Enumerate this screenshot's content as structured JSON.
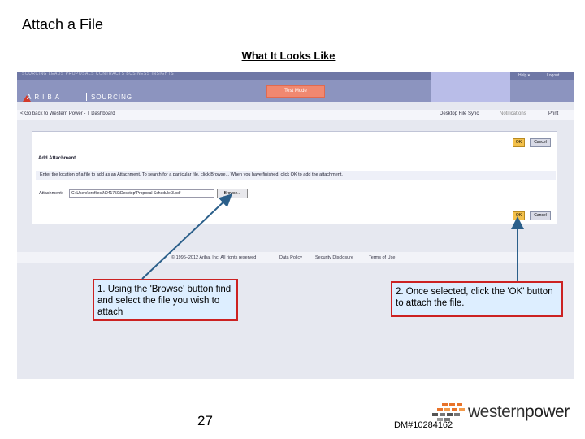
{
  "slide": {
    "title": "Attach a File",
    "subtitle": "What It Looks Like",
    "page_number": "27",
    "doc_number": "DM#10284162",
    "logo": {
      "western": "western",
      "power": "power"
    }
  },
  "app": {
    "top_tabs": "SOURCING   LEADS   PROPOSALS   CONTRACTS   BUSINESS INSIGHTS",
    "help": "Help ▾",
    "logout": "Logout",
    "test_mode": "Test Mode",
    "brand": "ARIBA",
    "module": "SOURCING",
    "back_link": "< Go back to Western Power - T Dashboard",
    "desktop_sync": "Desktop File Sync",
    "notifications": "Notifications",
    "print": "Print"
  },
  "dialog": {
    "title": "Add Attachment",
    "instructions": "Enter the location of a file to add as an Attachment. To search for a particular file, click Browse... When you have finished, click OK to add the attachment.",
    "attachment_label": "Attachment:",
    "attachment_value": "C:\\Users\\profiles\\N041750\\Desktop\\Proposal Schedule 3.pdf",
    "browse_label": "Browse...",
    "ok_label": "OK",
    "cancel_label": "Cancel"
  },
  "footer": {
    "copyright": "© 1996–2012 Ariba, Inc. All rights reserved",
    "data_policy": "Data Policy",
    "security": "Security Disclosure",
    "terms": "Terms of Use"
  },
  "callouts": {
    "browse": "1. Using the 'Browse' button find and select the file you wish to attach",
    "ok": "2. Once selected, click the 'OK' button to attach the file."
  },
  "colors": {
    "callout_border": "#cc2222",
    "callout_fill": "#ddeeff",
    "arrow": "#2b5f8a",
    "nav": "#6f78a6"
  }
}
